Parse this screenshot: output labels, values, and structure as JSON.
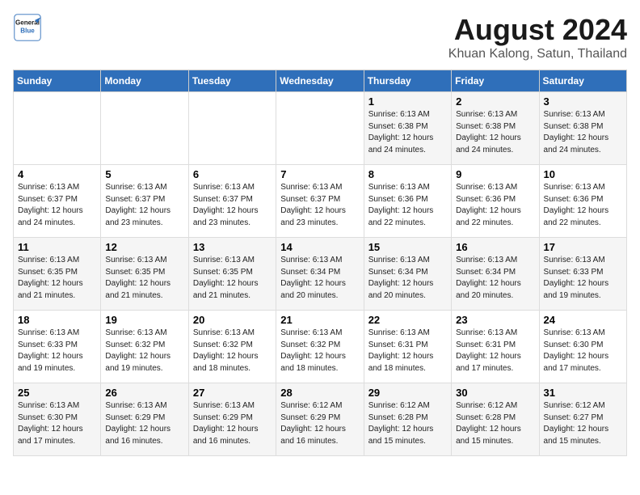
{
  "logo": {
    "line1": "General",
    "line2": "Blue"
  },
  "title": "August 2024",
  "subtitle": "Khuan Kalong, Satun, Thailand",
  "weekdays": [
    "Sunday",
    "Monday",
    "Tuesday",
    "Wednesday",
    "Thursday",
    "Friday",
    "Saturday"
  ],
  "weeks": [
    [
      {
        "day": "",
        "info": ""
      },
      {
        "day": "",
        "info": ""
      },
      {
        "day": "",
        "info": ""
      },
      {
        "day": "",
        "info": ""
      },
      {
        "day": "1",
        "info": "Sunrise: 6:13 AM\nSunset: 6:38 PM\nDaylight: 12 hours\nand 24 minutes."
      },
      {
        "day": "2",
        "info": "Sunrise: 6:13 AM\nSunset: 6:38 PM\nDaylight: 12 hours\nand 24 minutes."
      },
      {
        "day": "3",
        "info": "Sunrise: 6:13 AM\nSunset: 6:38 PM\nDaylight: 12 hours\nand 24 minutes."
      }
    ],
    [
      {
        "day": "4",
        "info": "Sunrise: 6:13 AM\nSunset: 6:37 PM\nDaylight: 12 hours\nand 24 minutes."
      },
      {
        "day": "5",
        "info": "Sunrise: 6:13 AM\nSunset: 6:37 PM\nDaylight: 12 hours\nand 23 minutes."
      },
      {
        "day": "6",
        "info": "Sunrise: 6:13 AM\nSunset: 6:37 PM\nDaylight: 12 hours\nand 23 minutes."
      },
      {
        "day": "7",
        "info": "Sunrise: 6:13 AM\nSunset: 6:37 PM\nDaylight: 12 hours\nand 23 minutes."
      },
      {
        "day": "8",
        "info": "Sunrise: 6:13 AM\nSunset: 6:36 PM\nDaylight: 12 hours\nand 22 minutes."
      },
      {
        "day": "9",
        "info": "Sunrise: 6:13 AM\nSunset: 6:36 PM\nDaylight: 12 hours\nand 22 minutes."
      },
      {
        "day": "10",
        "info": "Sunrise: 6:13 AM\nSunset: 6:36 PM\nDaylight: 12 hours\nand 22 minutes."
      }
    ],
    [
      {
        "day": "11",
        "info": "Sunrise: 6:13 AM\nSunset: 6:35 PM\nDaylight: 12 hours\nand 21 minutes."
      },
      {
        "day": "12",
        "info": "Sunrise: 6:13 AM\nSunset: 6:35 PM\nDaylight: 12 hours\nand 21 minutes."
      },
      {
        "day": "13",
        "info": "Sunrise: 6:13 AM\nSunset: 6:35 PM\nDaylight: 12 hours\nand 21 minutes."
      },
      {
        "day": "14",
        "info": "Sunrise: 6:13 AM\nSunset: 6:34 PM\nDaylight: 12 hours\nand 20 minutes."
      },
      {
        "day": "15",
        "info": "Sunrise: 6:13 AM\nSunset: 6:34 PM\nDaylight: 12 hours\nand 20 minutes."
      },
      {
        "day": "16",
        "info": "Sunrise: 6:13 AM\nSunset: 6:34 PM\nDaylight: 12 hours\nand 20 minutes."
      },
      {
        "day": "17",
        "info": "Sunrise: 6:13 AM\nSunset: 6:33 PM\nDaylight: 12 hours\nand 19 minutes."
      }
    ],
    [
      {
        "day": "18",
        "info": "Sunrise: 6:13 AM\nSunset: 6:33 PM\nDaylight: 12 hours\nand 19 minutes."
      },
      {
        "day": "19",
        "info": "Sunrise: 6:13 AM\nSunset: 6:32 PM\nDaylight: 12 hours\nand 19 minutes."
      },
      {
        "day": "20",
        "info": "Sunrise: 6:13 AM\nSunset: 6:32 PM\nDaylight: 12 hours\nand 18 minutes."
      },
      {
        "day": "21",
        "info": "Sunrise: 6:13 AM\nSunset: 6:32 PM\nDaylight: 12 hours\nand 18 minutes."
      },
      {
        "day": "22",
        "info": "Sunrise: 6:13 AM\nSunset: 6:31 PM\nDaylight: 12 hours\nand 18 minutes."
      },
      {
        "day": "23",
        "info": "Sunrise: 6:13 AM\nSunset: 6:31 PM\nDaylight: 12 hours\nand 17 minutes."
      },
      {
        "day": "24",
        "info": "Sunrise: 6:13 AM\nSunset: 6:30 PM\nDaylight: 12 hours\nand 17 minutes."
      }
    ],
    [
      {
        "day": "25",
        "info": "Sunrise: 6:13 AM\nSunset: 6:30 PM\nDaylight: 12 hours\nand 17 minutes."
      },
      {
        "day": "26",
        "info": "Sunrise: 6:13 AM\nSunset: 6:29 PM\nDaylight: 12 hours\nand 16 minutes."
      },
      {
        "day": "27",
        "info": "Sunrise: 6:13 AM\nSunset: 6:29 PM\nDaylight: 12 hours\nand 16 minutes."
      },
      {
        "day": "28",
        "info": "Sunrise: 6:12 AM\nSunset: 6:29 PM\nDaylight: 12 hours\nand 16 minutes."
      },
      {
        "day": "29",
        "info": "Sunrise: 6:12 AM\nSunset: 6:28 PM\nDaylight: 12 hours\nand 15 minutes."
      },
      {
        "day": "30",
        "info": "Sunrise: 6:12 AM\nSunset: 6:28 PM\nDaylight: 12 hours\nand 15 minutes."
      },
      {
        "day": "31",
        "info": "Sunrise: 6:12 AM\nSunset: 6:27 PM\nDaylight: 12 hours\nand 15 minutes."
      }
    ]
  ]
}
